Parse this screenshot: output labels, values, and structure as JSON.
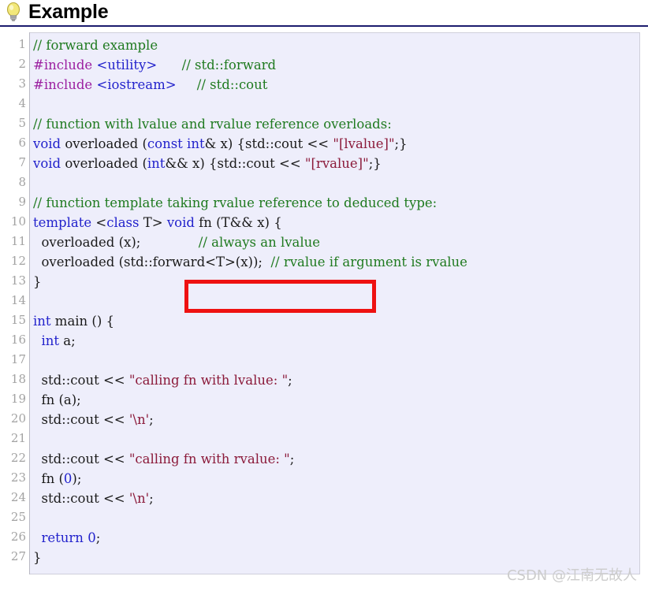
{
  "header": {
    "title": "Example",
    "icon": "lightbulb-icon",
    "rule_color": "#1c1c6e"
  },
  "code_block": {
    "language": "cpp",
    "background": "#eeeefb",
    "line_numbers": [
      "1",
      "2",
      "3",
      "4",
      "5",
      "6",
      "7",
      "8",
      "9",
      "10",
      "11",
      "12",
      "13",
      "14",
      "15",
      "16",
      "17",
      "18",
      "19",
      "20",
      "21",
      "22",
      "23",
      "24",
      "25",
      "26",
      "27"
    ],
    "lines": [
      {
        "n": "1",
        "tokens": [
          {
            "t": "// forward example",
            "c": "cm"
          }
        ]
      },
      {
        "n": "2",
        "tokens": [
          {
            "t": "#include ",
            "c": "pp"
          },
          {
            "t": "<utility>",
            "c": "inc"
          },
          {
            "t": "      ",
            "c": "pl"
          },
          {
            "t": "// std::forward",
            "c": "cm"
          }
        ]
      },
      {
        "n": "3",
        "tokens": [
          {
            "t": "#include ",
            "c": "pp"
          },
          {
            "t": "<iostream>",
            "c": "inc"
          },
          {
            "t": "     ",
            "c": "pl"
          },
          {
            "t": "// std::cout",
            "c": "cm"
          }
        ]
      },
      {
        "n": "4",
        "tokens": [
          {
            "t": "",
            "c": "pl"
          }
        ]
      },
      {
        "n": "5",
        "tokens": [
          {
            "t": "// function with lvalue and rvalue reference overloads:",
            "c": "cm"
          }
        ]
      },
      {
        "n": "6",
        "tokens": [
          {
            "t": "void",
            "c": "kw"
          },
          {
            "t": " overloaded (",
            "c": "pl"
          },
          {
            "t": "const",
            "c": "kw"
          },
          {
            "t": " ",
            "c": "pl"
          },
          {
            "t": "int",
            "c": "kw"
          },
          {
            "t": "& x) {std::cout << ",
            "c": "pl"
          },
          {
            "t": "\"[lvalue]\"",
            "c": "st"
          },
          {
            "t": ";}",
            "c": "pl"
          }
        ]
      },
      {
        "n": "7",
        "tokens": [
          {
            "t": "void",
            "c": "kw"
          },
          {
            "t": " overloaded (",
            "c": "pl"
          },
          {
            "t": "int",
            "c": "kw"
          },
          {
            "t": "&& x) {std::cout << ",
            "c": "pl"
          },
          {
            "t": "\"[rvalue]\"",
            "c": "st"
          },
          {
            "t": ";}",
            "c": "pl"
          }
        ]
      },
      {
        "n": "8",
        "tokens": [
          {
            "t": "",
            "c": "pl"
          }
        ]
      },
      {
        "n": "9",
        "tokens": [
          {
            "t": "// function template taking rvalue reference to deduced type:",
            "c": "cm"
          }
        ]
      },
      {
        "n": "10",
        "tokens": [
          {
            "t": "template",
            "c": "kw"
          },
          {
            "t": " <",
            "c": "pl"
          },
          {
            "t": "class",
            "c": "kw"
          },
          {
            "t": " T> ",
            "c": "pl"
          },
          {
            "t": "void",
            "c": "kw"
          },
          {
            "t": " fn (T&& x) {",
            "c": "pl"
          }
        ]
      },
      {
        "n": "11",
        "tokens": [
          {
            "t": "  overloaded (x);",
            "c": "pl"
          },
          {
            "t": "              ",
            "c": "pl"
          },
          {
            "t": "// always an lvalue",
            "c": "cm"
          }
        ]
      },
      {
        "n": "12",
        "tokens": [
          {
            "t": "  overloaded (std::forward<T>(x));",
            "c": "pl"
          },
          {
            "t": "  ",
            "c": "pl"
          },
          {
            "t": "// rvalue if argument is rvalue",
            "c": "cm"
          }
        ]
      },
      {
        "n": "13",
        "tokens": [
          {
            "t": "}",
            "c": "pl"
          }
        ]
      },
      {
        "n": "14",
        "tokens": [
          {
            "t": "",
            "c": "pl"
          }
        ]
      },
      {
        "n": "15",
        "tokens": [
          {
            "t": "int",
            "c": "kw"
          },
          {
            "t": " main () {",
            "c": "pl"
          }
        ]
      },
      {
        "n": "16",
        "tokens": [
          {
            "t": "  ",
            "c": "pl"
          },
          {
            "t": "int",
            "c": "kw"
          },
          {
            "t": " a;",
            "c": "pl"
          }
        ]
      },
      {
        "n": "17",
        "tokens": [
          {
            "t": "",
            "c": "pl"
          }
        ]
      },
      {
        "n": "18",
        "tokens": [
          {
            "t": "  std::cout << ",
            "c": "pl"
          },
          {
            "t": "\"calling fn with lvalue: \"",
            "c": "st"
          },
          {
            "t": ";",
            "c": "pl"
          }
        ]
      },
      {
        "n": "19",
        "tokens": [
          {
            "t": "  fn (a);",
            "c": "pl"
          }
        ]
      },
      {
        "n": "20",
        "tokens": [
          {
            "t": "  std::cout << ",
            "c": "pl"
          },
          {
            "t": "'\\n'",
            "c": "st"
          },
          {
            "t": ";",
            "c": "pl"
          }
        ]
      },
      {
        "n": "21",
        "tokens": [
          {
            "t": "",
            "c": "pl"
          }
        ]
      },
      {
        "n": "22",
        "tokens": [
          {
            "t": "  std::cout << ",
            "c": "pl"
          },
          {
            "t": "\"calling fn with rvalue: \"",
            "c": "st"
          },
          {
            "t": ";",
            "c": "pl"
          }
        ]
      },
      {
        "n": "23",
        "tokens": [
          {
            "t": "  fn (",
            "c": "pl"
          },
          {
            "t": "0",
            "c": "nm"
          },
          {
            "t": ");",
            "c": "pl"
          }
        ]
      },
      {
        "n": "24",
        "tokens": [
          {
            "t": "  std::cout << ",
            "c": "pl"
          },
          {
            "t": "'\\n'",
            "c": "st"
          },
          {
            "t": ";",
            "c": "pl"
          }
        ]
      },
      {
        "n": "25",
        "tokens": [
          {
            "t": "",
            "c": "pl"
          }
        ]
      },
      {
        "n": "26",
        "tokens": [
          {
            "t": "  ",
            "c": "pl"
          },
          {
            "t": "return",
            "c": "kw"
          },
          {
            "t": " ",
            "c": "pl"
          },
          {
            "t": "0",
            "c": "nm"
          },
          {
            "t": ";",
            "c": "pl"
          }
        ]
      },
      {
        "n": "27",
        "tokens": [
          {
            "t": "}",
            "c": "pl"
          }
        ]
      }
    ]
  },
  "annotation": {
    "name": "red-highlight-box",
    "color": "#ee1111",
    "targets_line": "12",
    "targets_text": "(std::forward<T>(x));"
  },
  "watermark": {
    "text": "CSDN @江南无故人",
    "color": "#cccccc"
  }
}
